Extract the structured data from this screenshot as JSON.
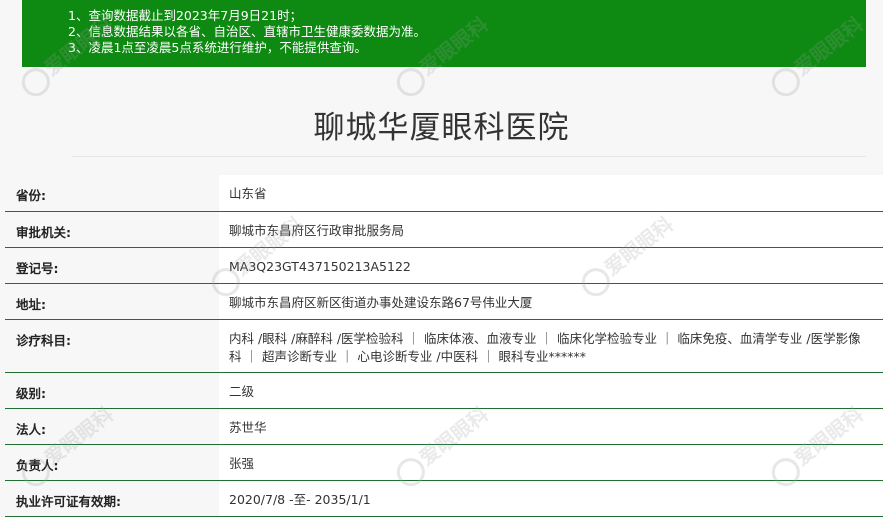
{
  "notice": {
    "lines": [
      "1、查询数据截止到2023年7月9日21时；",
      "2、信息数据结果以各省、自治区、直辖市卫生健康委数据为准。",
      "3、凌晨1点至凌晨5点系统进行维护，不能提供查询。"
    ],
    "background": "#0e8a12"
  },
  "hospital": {
    "name": "聊城华厦眼科医院"
  },
  "info": [
    {
      "label": "省份:",
      "value": "山东省"
    },
    {
      "label": "审批机关:",
      "value": "聊城市东昌府区行政审批服务局"
    },
    {
      "label": "登记号:",
      "value": "MA3Q23GT437150213A5122"
    },
    {
      "label": "地址:",
      "value": "聊城市东昌府区新区街道办事处建设东路67号伟业大厦"
    },
    {
      "label": "诊疗科目:",
      "value": "内科 /眼科 /麻醉科 /医学检验科 ｜ 临床体液、血液专业 ｜ 临床化学检验专业 ｜ 临床免疫、血清学专业 /医学影像科 ｜ 超声诊断专业 ｜ 心电诊断专业 /中医科 ｜ 眼科专业******"
    },
    {
      "label": "级别:",
      "value": "二级"
    },
    {
      "label": "法人:",
      "value": "苏世华"
    },
    {
      "label": "负责人:",
      "value": "张强"
    },
    {
      "label": "执业许可证有效期:",
      "value": "2020/7/8 -至- 2035/1/1"
    }
  ],
  "watermark": "爱眼眼科",
  "colors": {
    "row_border": "#1f6f32",
    "label_bg": "#f7f7f7",
    "value_bg": "#ffffff"
  }
}
